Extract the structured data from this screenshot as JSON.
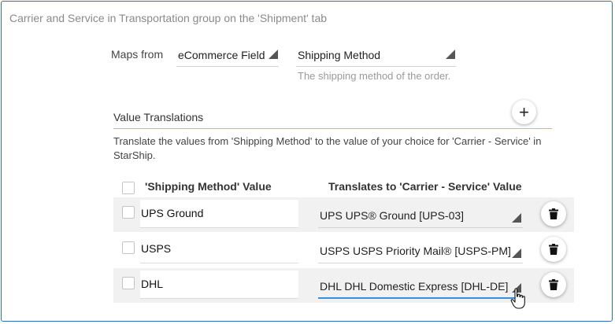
{
  "caption": "Carrier and Service in Transportation group on the 'Shipment' tab",
  "mapping": {
    "label": "Maps from",
    "source": "eCommerce Field",
    "field": "Shipping Method",
    "field_hint": "The shipping method of the order."
  },
  "translations": {
    "title": "Value Translations",
    "add_symbol": "+",
    "description": "Translate the values from 'Shipping Method' to the value of your choice for 'Carrier - Service' in StarShip.",
    "col_value": "'Shipping Method' Value",
    "col_translates": "Translates to 'Carrier - Service' Value",
    "rows": [
      {
        "value": "UPS Ground",
        "translation": "UPS UPS® Ground [UPS-03]"
      },
      {
        "value": "USPS",
        "translation": "USPS USPS Priority Mail® [USPS-PM]"
      },
      {
        "value": "DHL",
        "translation": "DHL DHL Domestic Express [DHL-DE]"
      }
    ]
  },
  "colors": {
    "accent": "#3b8ed8",
    "frame_border": "#2d6fb7",
    "row_alt": "#f1f1f1"
  },
  "icons": {
    "add": "plus-icon",
    "delete": "trash-icon",
    "dropdown": "dropdown-triangle-icon",
    "cursor": "hand-pointer-icon"
  }
}
